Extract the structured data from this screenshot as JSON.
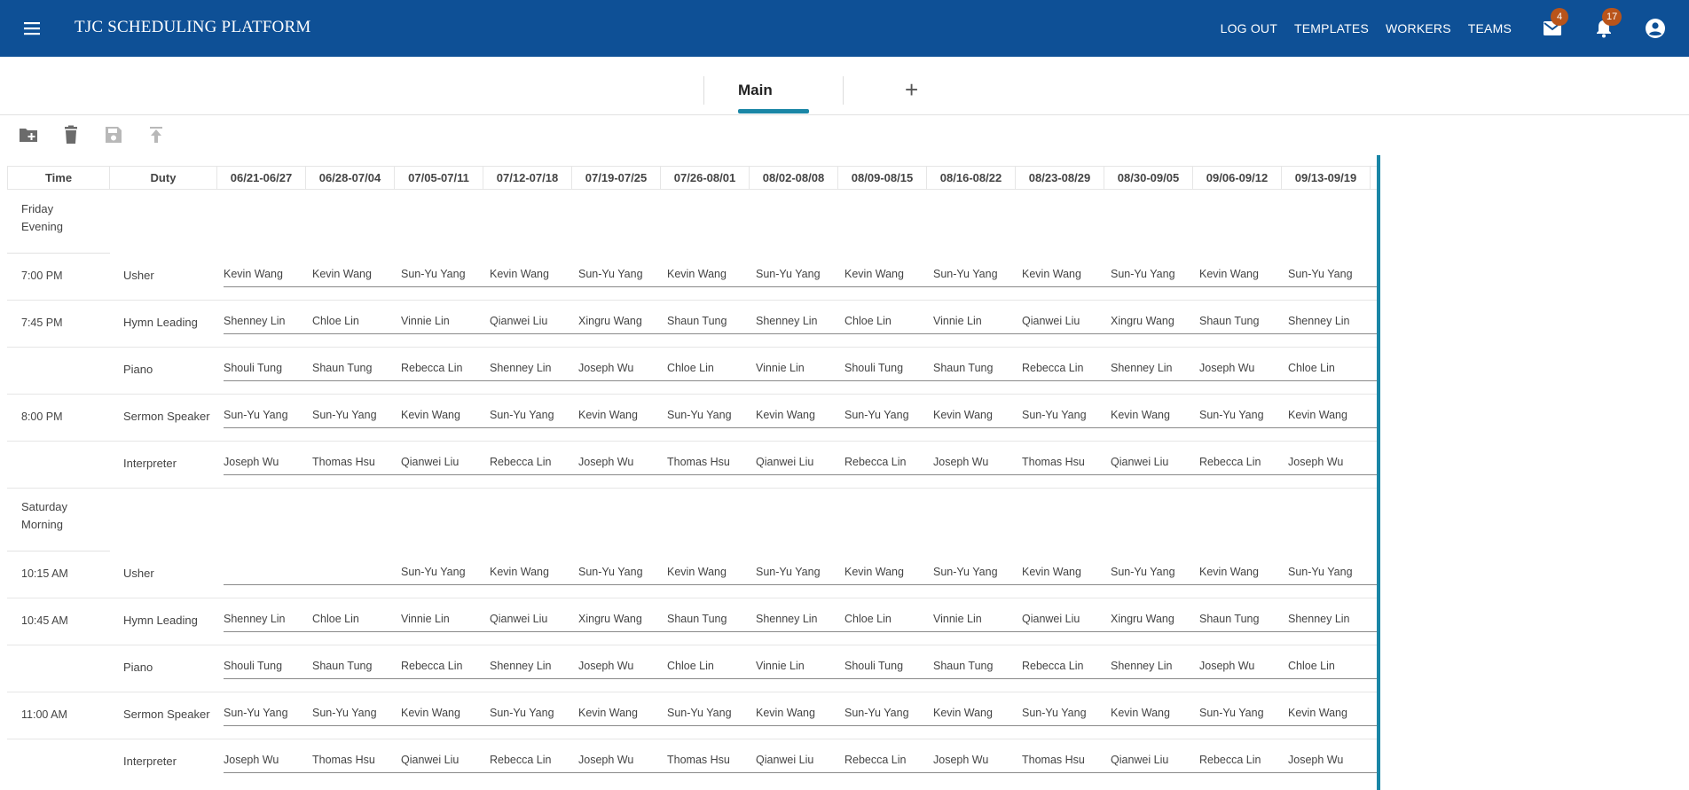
{
  "app": {
    "title": "TJC SCHEDULING PLATFORM",
    "nav": [
      "LOG OUT",
      "TEMPLATES",
      "WORKERS",
      "TEAMS"
    ],
    "mail_badge": "4",
    "notif_badge": "17",
    "brand_color": "#0e5096",
    "badge_color": "#b9541a",
    "accent_color": "#1a86a6"
  },
  "tabs": {
    "main_label": "Main",
    "add_label": "+"
  },
  "toolbar": {
    "icons": [
      "add-folder-icon",
      "delete-icon",
      "save-icon",
      "upload-icon"
    ]
  },
  "grid": {
    "time_header": "Time",
    "duty_header": "Duty",
    "weeks": [
      "06/21-06/27",
      "06/28-07/04",
      "07/05-07/11",
      "07/12-07/18",
      "07/19-07/25",
      "07/26-08/01",
      "08/02-08/08",
      "08/09-08/15",
      "08/16-08/22",
      "08/23-08/29",
      "08/30-09/05",
      "09/06-09/12",
      "09/13-09/19"
    ],
    "sections": [
      {
        "label_line1": "Friday",
        "label_line2": "Evening",
        "rows": [
          {
            "time": "7:00 PM",
            "duty": "Usher",
            "workers": [
              "Kevin Wang",
              "Kevin Wang",
              "Sun-Yu Yang",
              "Kevin Wang",
              "Sun-Yu Yang",
              "Kevin Wang",
              "Sun-Yu Yang",
              "Kevin Wang",
              "Sun-Yu Yang",
              "Kevin Wang",
              "Sun-Yu Yang",
              "Kevin Wang",
              "Sun-Yu Yang"
            ]
          },
          {
            "time": "7:45 PM",
            "duty": "Hymn Leading",
            "workers": [
              "Shenney Lin",
              "Chloe Lin",
              "Vinnie Lin",
              "Qianwei Liu",
              "Xingru Wang",
              "Shaun Tung",
              "Shenney Lin",
              "Chloe Lin",
              "Vinnie Lin",
              "Qianwei Liu",
              "Xingru Wang",
              "Shaun Tung",
              "Shenney Lin"
            ]
          },
          {
            "time": "",
            "duty": "Piano",
            "workers": [
              "Shouli Tung",
              "Shaun Tung",
              "Rebecca Lin",
              "Shenney Lin",
              "Joseph Wu",
              "Chloe Lin",
              "Vinnie Lin",
              "Shouli Tung",
              "Shaun Tung",
              "Rebecca Lin",
              "Shenney Lin",
              "Joseph Wu",
              "Chloe Lin"
            ]
          },
          {
            "time": "8:00 PM",
            "duty": "Sermon Speaker",
            "workers": [
              "Sun-Yu Yang",
              "Sun-Yu Yang",
              "Kevin Wang",
              "Sun-Yu Yang",
              "Kevin Wang",
              "Sun-Yu Yang",
              "Kevin Wang",
              "Sun-Yu Yang",
              "Kevin Wang",
              "Sun-Yu Yang",
              "Kevin Wang",
              "Sun-Yu Yang",
              "Kevin Wang"
            ]
          },
          {
            "time": "",
            "duty": "Interpreter",
            "workers": [
              "Joseph Wu",
              "Thomas Hsu",
              "Qianwei Liu",
              "Rebecca Lin",
              "Joseph Wu",
              "Thomas Hsu",
              "Qianwei Liu",
              "Rebecca Lin",
              "Joseph Wu",
              "Thomas Hsu",
              "Qianwei Liu",
              "Rebecca Lin",
              "Joseph Wu"
            ]
          }
        ]
      },
      {
        "label_line1": "Saturday",
        "label_line2": "Morning",
        "rows": [
          {
            "time": "10:15 AM",
            "duty": "Usher",
            "workers": [
              "",
              "",
              "Sun-Yu Yang",
              "Kevin Wang",
              "Sun-Yu Yang",
              "Kevin Wang",
              "Sun-Yu Yang",
              "Kevin Wang",
              "Sun-Yu Yang",
              "Kevin Wang",
              "Sun-Yu Yang",
              "Kevin Wang",
              "Sun-Yu Yang"
            ]
          },
          {
            "time": "10:45 AM",
            "duty": "Hymn Leading",
            "workers": [
              "Shenney Lin",
              "Chloe Lin",
              "Vinnie Lin",
              "Qianwei Liu",
              "Xingru Wang",
              "Shaun Tung",
              "Shenney Lin",
              "Chloe Lin",
              "Vinnie Lin",
              "Qianwei Liu",
              "Xingru Wang",
              "Shaun Tung",
              "Shenney Lin"
            ]
          },
          {
            "time": "",
            "duty": "Piano",
            "workers": [
              "Shouli Tung",
              "Shaun Tung",
              "Rebecca Lin",
              "Shenney Lin",
              "Joseph Wu",
              "Chloe Lin",
              "Vinnie Lin",
              "Shouli Tung",
              "Shaun Tung",
              "Rebecca Lin",
              "Shenney Lin",
              "Joseph Wu",
              "Chloe Lin"
            ]
          },
          {
            "time": "11:00 AM",
            "duty": "Sermon Speaker",
            "workers": [
              "Sun-Yu Yang",
              "Sun-Yu Yang",
              "Kevin Wang",
              "Sun-Yu Yang",
              "Kevin Wang",
              "Sun-Yu Yang",
              "Kevin Wang",
              "Sun-Yu Yang",
              "Kevin Wang",
              "Sun-Yu Yang",
              "Kevin Wang",
              "Sun-Yu Yang",
              "Kevin Wang"
            ]
          },
          {
            "time": "",
            "duty": "Interpreter",
            "workers": [
              "Joseph Wu",
              "Thomas Hsu",
              "Qianwei Liu",
              "Rebecca Lin",
              "Joseph Wu",
              "Thomas Hsu",
              "Qianwei Liu",
              "Rebecca Lin",
              "Joseph Wu",
              "Thomas Hsu",
              "Qianwei Liu",
              "Rebecca Lin",
              "Joseph Wu"
            ]
          }
        ]
      }
    ]
  }
}
